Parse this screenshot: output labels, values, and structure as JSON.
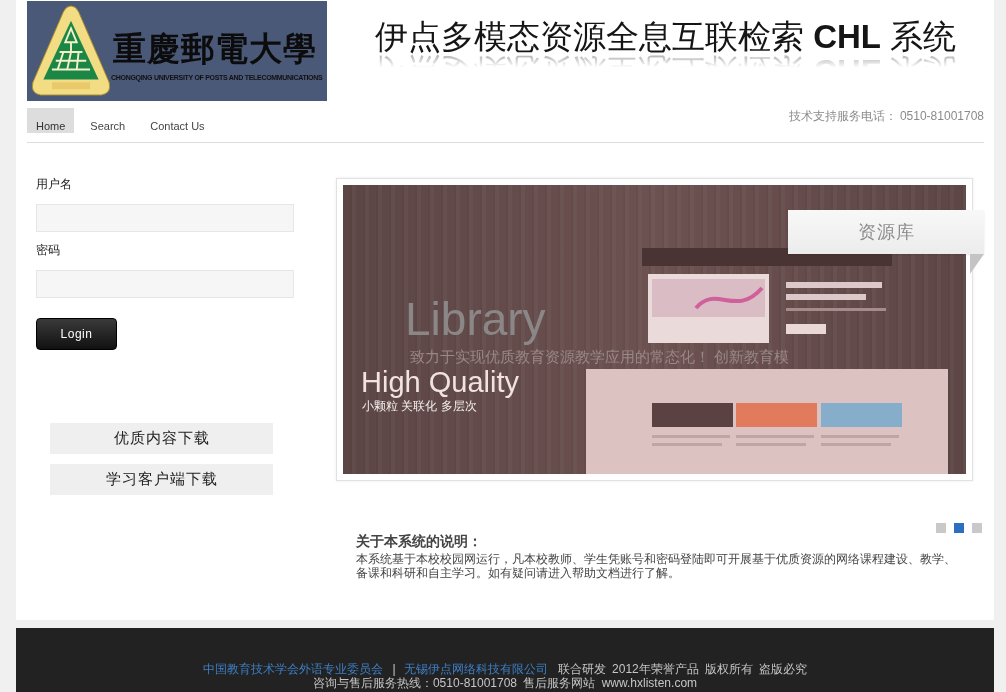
{
  "header": {
    "logo": {
      "name": "重慶郵電大學",
      "subtitle": "CHONGQING UNIVERSITY OF POSTS AND TELECOMMUNICATIONS"
    },
    "title": "伊点多模态资源全息互联检索 **CHL** 系统"
  },
  "nav": {
    "tabs": [
      {
        "label": "Home",
        "selected": true
      },
      {
        "label": "Search",
        "selected": false
      },
      {
        "label": "Contact Us",
        "selected": false
      }
    ],
    "support_phone": "技术支持服务电话： 0510-81001708"
  },
  "login": {
    "fields": [
      {
        "label": "用户名"
      },
      {
        "label": "密码"
      }
    ],
    "button": "Login"
  },
  "downloads": [
    "优质内容下载",
    "学习客户端下载"
  ],
  "slider": {
    "tag": "资源库",
    "captions": [
      {
        "kind": "faded",
        "title": "Library",
        "text": "致力于实现优质教育资源教学应用的常态化！ 创新教育模"
      },
      {
        "kind": "active",
        "title": "High Quality",
        "text": "小颗粒 关联化 多层次"
      }
    ],
    "dots": [
      {
        "selected": false
      },
      {
        "selected": true
      },
      {
        "selected": false
      }
    ]
  },
  "about": {
    "title": "关于本系统的说明：",
    "text": "本系统基于本校校园网运行，凡本校教师、学生凭账号和密码登陆即可开展基于优质资源的网络课程建设、教学、备课和科研和自主学习。如有疑问请进入帮助文档进行了解。"
  },
  "footer": {
    "line1": [
      {
        "kind": "link",
        "text": "中国教育技术学会外语专业委员会"
      },
      {
        "kind": "separator",
        "text": "|"
      },
      {
        "kind": "link",
        "text": "无锡伊点网络科技有限公司"
      },
      {
        "kind": "text",
        "text": "联合研发 2012年荣誉产品 版权所有 盗版必究"
      }
    ],
    "contact": "咨询与售后服务热线：0510-81001708 售后服务网站 www.hxlisten.com"
  }
}
